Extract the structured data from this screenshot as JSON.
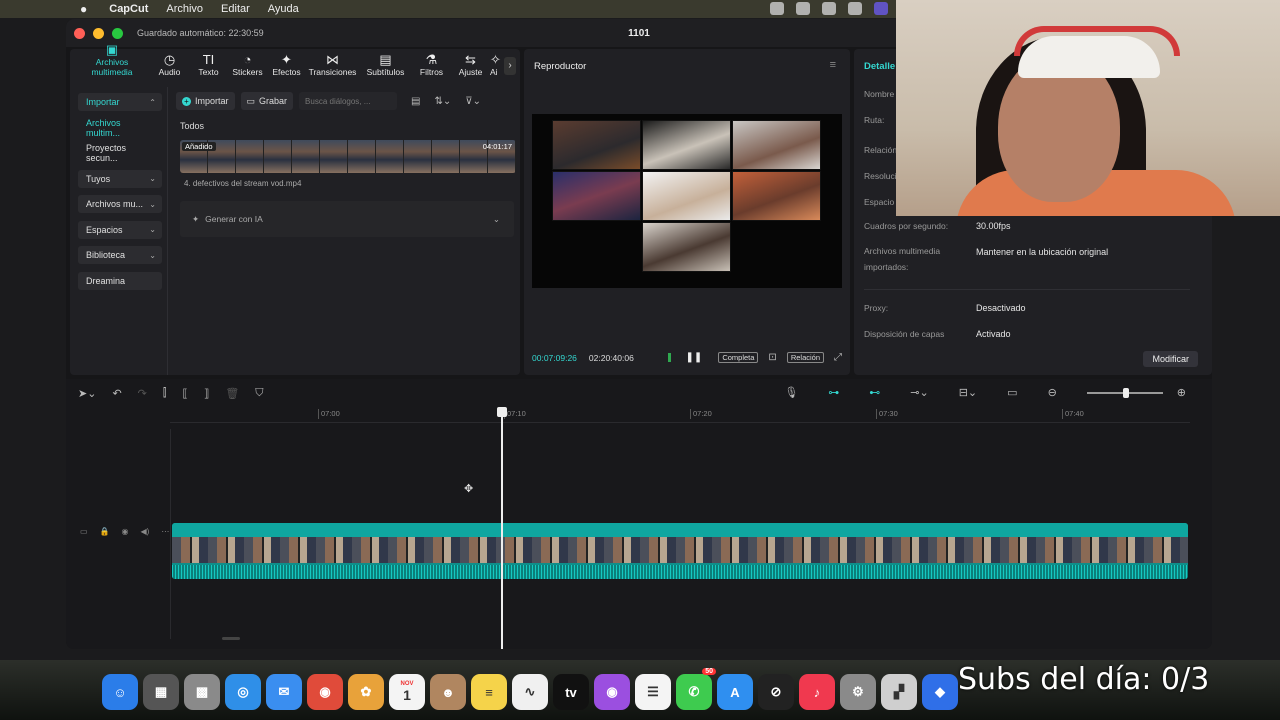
{
  "menubar": {
    "app_name": "CapCut",
    "items": [
      "Archivo",
      "Editar",
      "Ayuda"
    ]
  },
  "window": {
    "autosave": "Guardado automático: 22:30:59",
    "project_title": "1101"
  },
  "media": {
    "tools": [
      {
        "label": "Archivos multimedia",
        "icon": "▣",
        "active": true
      },
      {
        "label": "Audio",
        "icon": "◷"
      },
      {
        "label": "Texto",
        "icon": "TI"
      },
      {
        "label": "Stickers",
        "icon": "◔"
      },
      {
        "label": "Efectos",
        "icon": "✦"
      },
      {
        "label": "Transiciones",
        "icon": "⋈"
      },
      {
        "label": "Subtítulos",
        "icon": "▤"
      },
      {
        "label": "Filtros",
        "icon": "⚗"
      },
      {
        "label": "Ajuste",
        "icon": "⇆"
      },
      {
        "label": "Ai",
        "icon": "✧"
      }
    ],
    "sidebar": [
      {
        "label": "Importar",
        "teal": true,
        "box": true,
        "chev": "⌃"
      },
      {
        "label": "Archivos multim...",
        "teal": true,
        "box": false,
        "chev": ""
      },
      {
        "label": "Proyectos secun...",
        "teal": false,
        "box": false,
        "chev": ""
      },
      {
        "label": "Tuyos",
        "teal": false,
        "box": true,
        "chev": "⌄"
      },
      {
        "label": "Archivos mu...",
        "teal": false,
        "box": true,
        "chev": "⌄"
      },
      {
        "label": "Espacios",
        "teal": false,
        "box": true,
        "chev": "⌄"
      },
      {
        "label": "Biblioteca",
        "teal": false,
        "box": true,
        "chev": "⌄"
      },
      {
        "label": "Dreamina",
        "teal": false,
        "box": true,
        "chev": ""
      }
    ],
    "import_label": "Importar",
    "record_label": "Grabar",
    "search_placeholder": "Busca diálogos, ...",
    "filter_all": "Todos",
    "clip_badge": "Añadido",
    "clip_duration": "04:01:17",
    "clip_name": "4. defectivos del stream vod.mp4",
    "generate_label": "Generar con IA"
  },
  "player": {
    "title": "Reproductor",
    "current_time": "00:07:09:26",
    "total_time": "02:20:40:06",
    "complete_label": "Completa",
    "ratio_label": "Relación"
  },
  "details": {
    "title": "Detalle",
    "rows": [
      {
        "label": "Nombre",
        "value": ""
      },
      {
        "label": "Ruta:",
        "value": ""
      },
      {
        "label": "Relación",
        "value": ""
      },
      {
        "label": "Resolución",
        "value": ""
      },
      {
        "label": "Espacio",
        "value": ""
      },
      {
        "label": "Cuadros por segundo:",
        "value": "30.00fps"
      },
      {
        "label": "Archivos multimedia importados:",
        "value": "Mantener en la ubicación original"
      },
      {
        "label": "Proxy:",
        "value": "Desactivado"
      },
      {
        "label": "Disposición de capas",
        "value": "Activado"
      }
    ],
    "modify_label": "Modificar"
  },
  "timeline": {
    "ruler": [
      "07:00",
      "07:10",
      "07:20",
      "07:30",
      "07:40"
    ]
  },
  "overlay": {
    "text": "Subs del día: 0/3"
  },
  "dock": {
    "apps": [
      {
        "name": "finder-icon",
        "color": "#2b7de9",
        "glyph": "☺"
      },
      {
        "name": "calculator-icon",
        "color": "#555555",
        "glyph": "▦"
      },
      {
        "name": "launchpad-icon",
        "color": "#8a8a8a",
        "glyph": "▩"
      },
      {
        "name": "safari-icon",
        "color": "#2f8fe8",
        "glyph": "◎"
      },
      {
        "name": "mail-icon",
        "color": "#3a8ef0",
        "glyph": "✉"
      },
      {
        "name": "chrome-icon",
        "color": "#e04b3a",
        "glyph": "◉"
      },
      {
        "name": "photos-icon",
        "color": "#e8a23a",
        "glyph": "✿"
      },
      {
        "name": "calendar-icon",
        "color": "#f4f4f4",
        "glyph": "1"
      },
      {
        "name": "contacts-icon",
        "color": "#b08660",
        "glyph": "☻"
      },
      {
        "name": "notes-icon",
        "color": "#f5d34a",
        "glyph": "≡"
      },
      {
        "name": "freeform-icon",
        "color": "#f0f0f0",
        "glyph": "∿"
      },
      {
        "name": "appletv-icon",
        "color": "#111111",
        "glyph": "tv"
      },
      {
        "name": "podcasts-icon",
        "color": "#9b4fe0",
        "glyph": "◉"
      },
      {
        "name": "reminders-icon",
        "color": "#f4f4f4",
        "glyph": "☰"
      },
      {
        "name": "messages-icon",
        "color": "#3ecb4f",
        "glyph": "✆"
      },
      {
        "name": "appstore-icon",
        "color": "#2f8ff0",
        "glyph": "A"
      },
      {
        "name": "capcut-icon",
        "color": "#222222",
        "glyph": "⊘"
      },
      {
        "name": "music-icon",
        "color": "#f0394f",
        "glyph": "♪"
      },
      {
        "name": "settings-icon",
        "color": "#8a8a8a",
        "glyph": "⚙"
      },
      {
        "name": "files-icon",
        "color": "#cfcfcf",
        "glyph": "▞"
      },
      {
        "name": "roblox-icon",
        "color": "#2f6fe8",
        "glyph": "◆"
      }
    ],
    "badge_messages": "50",
    "calendar_month": "NOV"
  }
}
